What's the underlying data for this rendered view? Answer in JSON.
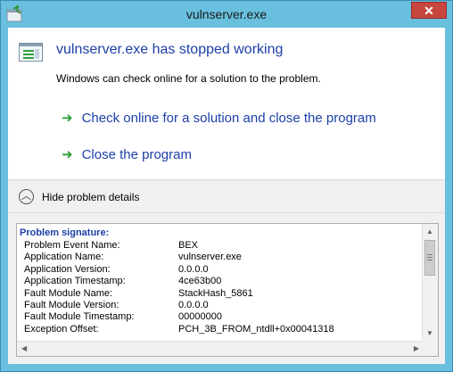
{
  "window": {
    "title": "vulnserver.exe",
    "close_glyph": "✕"
  },
  "header": {
    "title": "vulnserver.exe has stopped working",
    "subtext": "Windows can check online for a solution to the problem."
  },
  "commands": [
    {
      "label": "Check online for a solution and close the program",
      "icon": "green-arrow-icon"
    },
    {
      "label": "Close the program",
      "icon": "green-arrow-icon"
    }
  ],
  "details_toggle": {
    "label": "Hide problem details",
    "icon": "chevron-up-icon"
  },
  "problem_details": {
    "heading": "Problem signature:",
    "rows": [
      {
        "key": "Problem Event Name:",
        "value": "BEX"
      },
      {
        "key": "Application Name:",
        "value": "vulnserver.exe"
      },
      {
        "key": "Application Version:",
        "value": "0.0.0.0"
      },
      {
        "key": "Application Timestamp:",
        "value": "4ce63b00"
      },
      {
        "key": "Fault Module Name:",
        "value": "StackHash_5861"
      },
      {
        "key": "Fault Module Version:",
        "value": "0.0.0.0"
      },
      {
        "key": "Fault Module Timestamp:",
        "value": "00000000"
      },
      {
        "key": "Exception Offset:",
        "value": "PCH_3B_FROM_ntdll+0x00041318"
      }
    ]
  },
  "colors": {
    "frame": "#68c0de",
    "link_blue": "#1c3fa8",
    "arrow_green": "#2e9d3a",
    "close_red": "#c7463e"
  }
}
